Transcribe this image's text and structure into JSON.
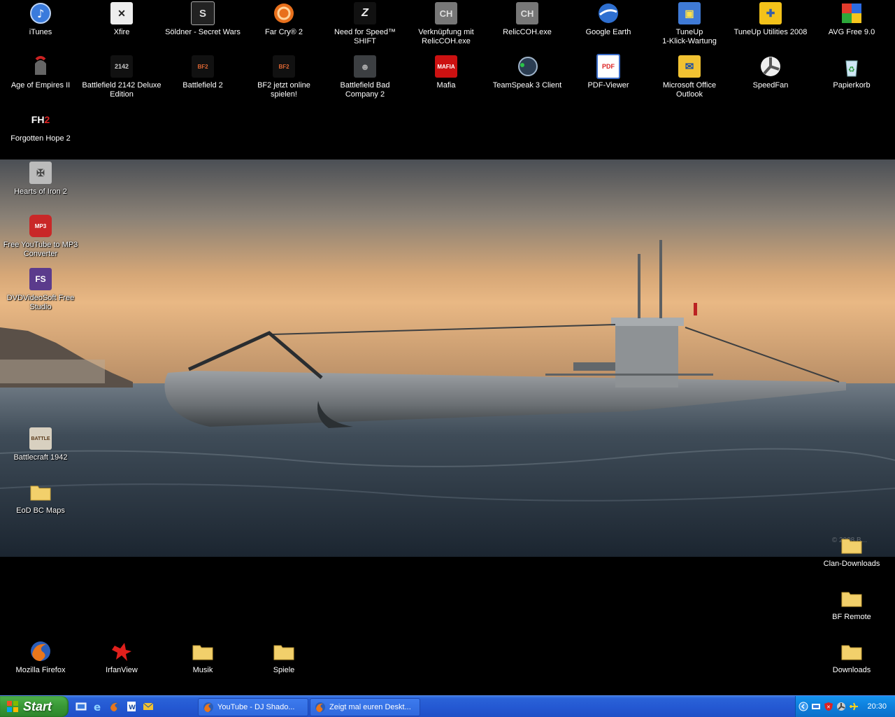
{
  "desktop_icons": [
    {
      "label": "iTunes",
      "icon": "itunes-icon"
    },
    {
      "label": "Xfire",
      "icon": "xfire-icon"
    },
    {
      "label": "Söldner - Secret Wars",
      "icon": "soldner-icon"
    },
    {
      "label": "Far Cry® 2",
      "icon": "farcry2-icon"
    },
    {
      "label": "Need for Speed™\nSHIFT",
      "icon": "nfs-shift-icon"
    },
    {
      "label": "Verknüpfung mit\nRelicCOH.exe",
      "icon": "coh-shortcut-icon"
    },
    {
      "label": "RelicCOH.exe",
      "icon": "coh-icon"
    },
    {
      "label": "Google Earth",
      "icon": "google-earth-icon"
    },
    {
      "label": "TuneUp\n1-Klick-Wartung",
      "icon": "tuneup-1click-icon"
    },
    {
      "label": "TuneUp Utilities 2008",
      "icon": "tuneup-utilities-icon"
    },
    {
      "label": "AVG Free 9.0",
      "icon": "avg-icon"
    },
    {
      "label": "Age of Empires II",
      "icon": "aoe2-icon"
    },
    {
      "label": "Battlefield 2142 Deluxe\nEdition",
      "icon": "bf2142-icon"
    },
    {
      "label": "Battlefield 2",
      "icon": "bf2-icon"
    },
    {
      "label": "BF2 jetzt online\nspielen!",
      "icon": "bf2-online-icon"
    },
    {
      "label": "Battlefield Bad\nCompany 2",
      "icon": "bfbc2-icon"
    },
    {
      "label": "Mafia",
      "icon": "mafia-icon"
    },
    {
      "label": "TeamSpeak 3 Client",
      "icon": "teamspeak-icon"
    },
    {
      "label": "PDF-Viewer",
      "icon": "pdf-icon"
    },
    {
      "label": "Microsoft Office\nOutlook",
      "icon": "outlook-icon"
    },
    {
      "label": "SpeedFan",
      "icon": "speedfan-icon"
    },
    {
      "label": "Papierkorb",
      "icon": "recycle-bin-icon"
    },
    {
      "label": "Forgotten Hope 2",
      "icon": "fh2-icon"
    },
    {
      "label": "Hearts of Iron 2",
      "icon": "hoi2-icon"
    },
    {
      "label": "Free YouTube to MP3\nConverter",
      "icon": "yt-mp3-icon"
    },
    {
      "label": "DVDVideoSoft Free\nStudio",
      "icon": "dvdvideosoft-icon"
    },
    {
      "label": "Battlecraft 1942",
      "icon": "battlecraft-icon"
    },
    {
      "label": "EoD BC Maps",
      "icon": "folder-icon"
    },
    {
      "label": "Clan-Downloads",
      "icon": "folder-icon"
    },
    {
      "label": "BF Remote",
      "icon": "folder-icon"
    },
    {
      "label": "Mozilla Firefox",
      "icon": "firefox-icon"
    },
    {
      "label": "IrfanView",
      "icon": "irfanview-icon"
    },
    {
      "label": "Musik",
      "icon": "folder-icon"
    },
    {
      "label": "Spiele",
      "icon": "folder-icon"
    },
    {
      "label": "Downloads",
      "icon": "folder-icon"
    }
  ],
  "wallpaper": {
    "watermark": "© 2008 B..."
  },
  "taskbar": {
    "start_label": "Start",
    "quick_launch": [
      "show-desktop-icon",
      "internet-explorer-icon",
      "firefox-icon",
      "word-icon",
      "outlook-icon"
    ],
    "tasks": [
      {
        "label": "YouTube - DJ Shado...",
        "icon": "firefox-icon"
      },
      {
        "label": "Zeigt mal euren Deskt...",
        "icon": "firefox-icon"
      }
    ],
    "tray_icons": [
      "expand-tray-icon",
      "network-icon",
      "security-icon",
      "speedfan-tray-icon",
      "airplane-icon"
    ],
    "clock": "20:30"
  },
  "colors": {
    "taskbar_blue": "#245edb",
    "start_green": "#3a9a37",
    "tray_blue": "#0e7fdc"
  }
}
